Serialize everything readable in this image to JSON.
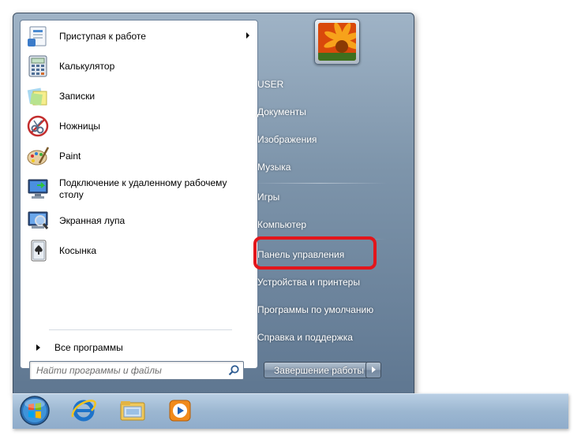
{
  "programs": [
    {
      "label": "Приступая к работе",
      "icon": "getting-started-icon",
      "has_submenu": true
    },
    {
      "label": "Калькулятор",
      "icon": "calculator-icon",
      "has_submenu": false
    },
    {
      "label": "Записки",
      "icon": "sticky-notes-icon",
      "has_submenu": false
    },
    {
      "label": "Ножницы",
      "icon": "snipping-tool-icon",
      "has_submenu": false
    },
    {
      "label": "Paint",
      "icon": "paint-icon",
      "has_submenu": false
    },
    {
      "label": "Подключение к удаленному рабочему столу",
      "icon": "remote-desktop-icon",
      "has_submenu": false
    },
    {
      "label": "Экранная лупа",
      "icon": "magnifier-icon",
      "has_submenu": false
    },
    {
      "label": "Косынка",
      "icon": "solitaire-icon",
      "has_submenu": false
    }
  ],
  "all_programs_label": "Все программы",
  "search": {
    "placeholder": "Найти программы и файлы"
  },
  "right_items": {
    "user": "USER",
    "documents": "Документы",
    "pictures": "Изображения",
    "music": "Музыка",
    "games": "Игры",
    "computer": "Компьютер",
    "control_panel": "Панель управления",
    "devices": "Устройства и принтеры",
    "default_programs": "Программы по умолчанию",
    "help": "Справка и поддержка"
  },
  "shutdown_label": "Завершение работы",
  "highlight_color": "#e3151b",
  "taskbar_icons": [
    "start-orb-icon",
    "internet-explorer-icon",
    "windows-explorer-icon",
    "media-player-icon"
  ]
}
